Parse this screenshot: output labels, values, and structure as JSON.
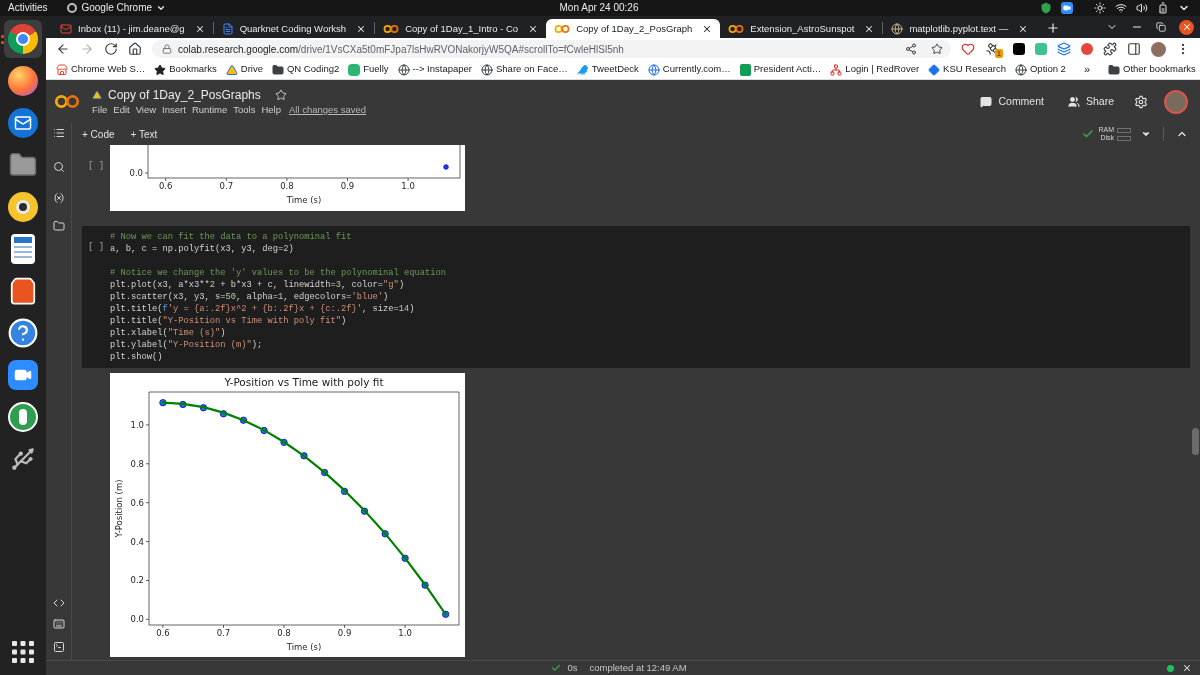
{
  "topbar": {
    "activities": "Activities",
    "app_menu": "Google Chrome",
    "clock": "Mon Apr 24 00:26"
  },
  "dock": [
    {
      "selected": true,
      "running": true
    },
    {
      "selected": false,
      "running": false
    },
    {
      "selected": false,
      "running": false
    },
    {
      "selected": false,
      "running": false
    },
    {
      "selected": false,
      "running": false
    },
    {
      "selected": false,
      "running": false
    },
    {
      "selected": false,
      "running": false
    },
    {
      "selected": false,
      "running": false
    },
    {
      "selected": false,
      "running": false
    },
    {
      "selected": false,
      "running": false
    },
    {
      "selected": false,
      "running": false
    }
  ],
  "browser": {
    "tabs": [
      {
        "title": "Inbox (11) - jim.deane@g",
        "selected": false
      },
      {
        "title": "Quarknet Coding Worksh",
        "selected": false
      },
      {
        "title": "Copy of 1Day_1_Intro - Co",
        "selected": false
      },
      {
        "title": "Copy of 1Day_2_PosGraph",
        "selected": true
      },
      {
        "title": "Extension_AstroSunspot",
        "selected": false
      },
      {
        "title": "matplotlib.pyplot.text —",
        "selected": false
      }
    ],
    "address": {
      "host": "colab.research.google.com",
      "path": "/drive/1VsCXa5t0mFJpa7lsHwRVONakorjyW5QA#scrollTo=fCwleHlSl5nh"
    },
    "extension_badge": "1",
    "bookmarks": [
      "Chrome Web S…",
      "Bookmarks",
      "Drive",
      "QN Coding2",
      "Fuelly",
      "--> Instapaper",
      "Share on Face…",
      "TweetDeck",
      "Currently.com…",
      "President Acti…",
      "Login | RedRover",
      "KSU Research",
      "Option 2"
    ],
    "bookmarks_overflow": "»",
    "other_bookmarks": "Other bookmarks"
  },
  "colab": {
    "title": "Copy of 1Day_2_PosGraphs",
    "menu": [
      "File",
      "Edit",
      "View",
      "Insert",
      "Runtime",
      "Tools",
      "Help"
    ],
    "save_status": "All changes saved",
    "comment": "Comment",
    "share": "Share",
    "toolbar": {
      "add_code": "+ Code",
      "add_text": "+ Text",
      "ram": "RAM",
      "disk": "Disk"
    },
    "cells": [
      {
        "bracket": "[ ]",
        "output": {
          "plot": {
            "xtick_labels": [
              "0.6",
              "0.7",
              "0.8",
              "0.9",
              "1.0"
            ],
            "ytick_labels": [
              "0.0"
            ],
            "xlabel": "Time (s)"
          }
        }
      },
      {
        "bracket": "[ ]",
        "code": "# Now we can fit the data to a polynominal fit\na, b, c = np.polyfit(x3, y3, deg=2)\n\n# Notice we change the 'y' values to be the polynominal equation\nplt.plot(x3, a*x3**2 + b*x3 + c, linewidth=3, color=\"g\")\nplt.scatter(x3, y3, s=50, alpha=1, edgecolors='blue')\nplt.title(f'y = {a:.2f}x^2 + {b:.2f}x + {c:.2f}', size=14)\nplt.title(\"Y-Position vs Time with poly fit\")\nplt.xlabel(\"Time (s)\")\nplt.ylabel(\"Y-Position (m)\");\nplt.show()",
        "output": {
          "chart_data": [
            {
              "type": "scatter",
              "title": "Y-Position vs Time with poly fit",
              "xlabel": "Time (s)",
              "ylabel": "Y-Position (m)",
              "xlim": [
                0.577,
                1.089
              ],
              "ylim": [
                -0.029,
                1.169
              ],
              "xticks": [
                0.6,
                0.7,
                0.8,
                0.9,
                {
                  "value": 1.0,
                  "label": "1.0"
                }
              ],
              "yticks": [
                {
                  "value": 0,
                  "label": "0.0"
                },
                0.2,
                0.4,
                0.6,
                0.8,
                {
                  "value": 1.0,
                  "label": "1.0"
                }
              ],
              "series": [
                {
                  "color": "#1f77b4",
                  "x": [
                    0.6,
                    0.633,
                    0.667,
                    0.7,
                    0.733,
                    0.767,
                    0.8,
                    0.833,
                    0.867,
                    0.9,
                    0.933,
                    0.967,
                    1.0,
                    1.033,
                    1.067
                  ],
                  "values": [
                    1.114,
                    1.105,
                    1.088,
                    1.057,
                    1.024,
                    0.971,
                    0.91,
                    0.841,
                    0.755,
                    0.658,
                    0.556,
                    0.44,
                    0.314,
                    0.176,
                    0.026
                  ]
                },
                {
                  "type": "line",
                  "color": "#008000",
                  "x": [
                    0.6,
                    0.633,
                    0.667,
                    0.7,
                    0.733,
                    0.767,
                    0.8,
                    0.833,
                    0.867,
                    0.9,
                    0.933,
                    0.967,
                    1.0,
                    1.033,
                    1.067
                  ],
                  "values": [
                    1.114,
                    1.108,
                    1.091,
                    1.063,
                    1.024,
                    0.973,
                    0.912,
                    0.841,
                    0.756,
                    0.663,
                    0.559,
                    0.441,
                    0.315,
                    0.178,
                    0.026
                  ]
                }
              ]
            }
          ]
        }
      }
    ],
    "status": {
      "duration": "0s",
      "message": "completed at 12:49 AM"
    }
  }
}
